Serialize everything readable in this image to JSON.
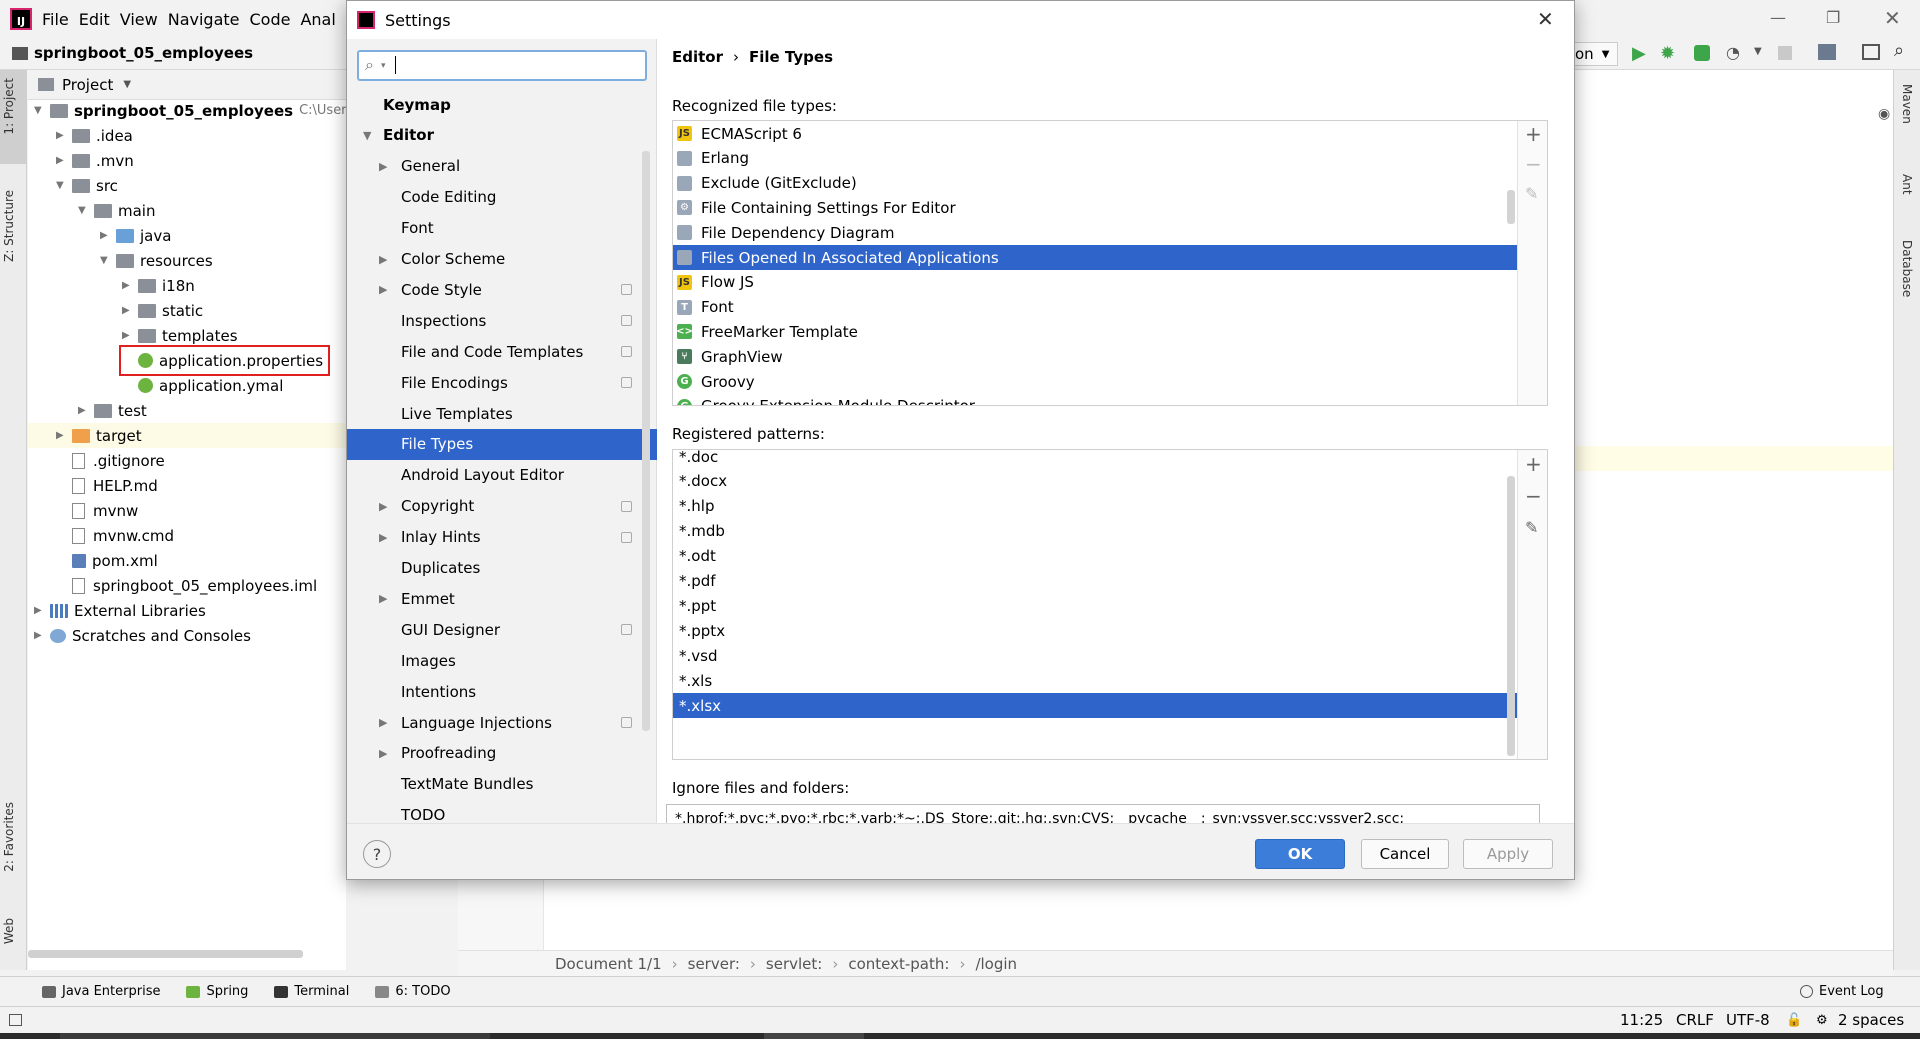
{
  "ide": {
    "menu": [
      "File",
      "Edit",
      "View",
      "Navigate",
      "Code",
      "Anal"
    ],
    "project_name": "springboot_05_employees",
    "project_tab": "Project",
    "left_tabs": [
      "1: Project",
      "Z: Structure",
      "2: Favorites",
      "Web"
    ],
    "right_tabs": [
      "Maven",
      "Ant",
      "Database"
    ],
    "run_config_partial": "on",
    "tree": [
      {
        "label": "springboot_05_employees",
        "extra": "C:\\Users\\",
        "indent": 0,
        "expanded": true,
        "icon": "folder-module"
      },
      {
        "label": ".idea",
        "indent": 1,
        "expanded": false,
        "icon": "folder"
      },
      {
        "label": ".mvn",
        "indent": 1,
        "expanded": false,
        "icon": "folder"
      },
      {
        "label": "src",
        "indent": 1,
        "expanded": true,
        "icon": "folder"
      },
      {
        "label": "main",
        "indent": 2,
        "expanded": true,
        "icon": "folder"
      },
      {
        "label": "java",
        "indent": 3,
        "expanded": false,
        "icon": "folder-blue"
      },
      {
        "label": "resources",
        "indent": 3,
        "expanded": true,
        "icon": "folder"
      },
      {
        "label": "i18n",
        "indent": 4,
        "expanded": false,
        "icon": "folder"
      },
      {
        "label": "static",
        "indent": 4,
        "expanded": false,
        "icon": "folder"
      },
      {
        "label": "templates",
        "indent": 4,
        "expanded": false,
        "icon": "folder"
      },
      {
        "label": "application.properties",
        "indent": 4,
        "leaf": true,
        "icon": "spring-file",
        "highlighted": true
      },
      {
        "label": "application.ymal",
        "indent": 4,
        "leaf": true,
        "icon": "spring-file"
      },
      {
        "label": "test",
        "indent": 2,
        "expanded": false,
        "icon": "folder"
      },
      {
        "label": "target",
        "indent": 1,
        "expanded": false,
        "icon": "folder-orange"
      },
      {
        "label": ".gitignore",
        "indent": 1,
        "leaf": true,
        "icon": "file"
      },
      {
        "label": "HELP.md",
        "indent": 1,
        "leaf": true,
        "icon": "md-file"
      },
      {
        "label": "mvnw",
        "indent": 1,
        "leaf": true,
        "icon": "file"
      },
      {
        "label": "mvnw.cmd",
        "indent": 1,
        "leaf": true,
        "icon": "file"
      },
      {
        "label": "pom.xml",
        "indent": 1,
        "leaf": true,
        "icon": "maven-file"
      },
      {
        "label": "springboot_05_employees.iml",
        "indent": 1,
        "leaf": true,
        "icon": "file"
      },
      {
        "label": "External Libraries",
        "indent": 0,
        "expanded": false,
        "icon": "library"
      },
      {
        "label": "Scratches and Consoles",
        "indent": 0,
        "expanded": false,
        "icon": "scratches"
      }
    ],
    "breadcrumb": [
      "Document 1/1",
      "server:",
      "servlet:",
      "context-path:",
      "/login"
    ],
    "tool_windows": [
      "Java Enterprise",
      "Spring",
      "Terminal",
      "6: TODO"
    ],
    "event_log": "Event Log",
    "status": {
      "position": "11:25",
      "line_sep": "CRLF",
      "encoding": "UTF-8",
      "indent": "2 spaces"
    }
  },
  "dialog": {
    "title": "Settings",
    "search": {
      "value": "",
      "placeholder": ""
    },
    "nav": [
      {
        "label": "Keymap",
        "level": 0,
        "bold": true
      },
      {
        "label": "Editor",
        "level": 0,
        "bold": true,
        "expanded": true
      },
      {
        "label": "General",
        "level": 1,
        "arrow": true
      },
      {
        "label": "Code Editing",
        "level": 1
      },
      {
        "label": "Font",
        "level": 1
      },
      {
        "label": "Color Scheme",
        "level": 1,
        "arrow": true
      },
      {
        "label": "Code Style",
        "level": 1,
        "arrow": true,
        "project": true
      },
      {
        "label": "Inspections",
        "level": 1,
        "project": true
      },
      {
        "label": "File and Code Templates",
        "level": 1,
        "project": true
      },
      {
        "label": "File Encodings",
        "level": 1,
        "project": true
      },
      {
        "label": "Live Templates",
        "level": 1
      },
      {
        "label": "File Types",
        "level": 1,
        "selected": true
      },
      {
        "label": "Android Layout Editor",
        "level": 1
      },
      {
        "label": "Copyright",
        "level": 1,
        "arrow": true,
        "project": true
      },
      {
        "label": "Inlay Hints",
        "level": 1,
        "arrow": true,
        "project": true
      },
      {
        "label": "Duplicates",
        "level": 1
      },
      {
        "label": "Emmet",
        "level": 1,
        "arrow": true
      },
      {
        "label": "GUI Designer",
        "level": 1,
        "project": true
      },
      {
        "label": "Images",
        "level": 1
      },
      {
        "label": "Intentions",
        "level": 1
      },
      {
        "label": "Language Injections",
        "level": 1,
        "arrow": true,
        "project": true
      },
      {
        "label": "Proofreading",
        "level": 1,
        "arrow": true
      },
      {
        "label": "TextMate Bundles",
        "level": 1
      },
      {
        "label": "TODO",
        "level": 1
      }
    ],
    "breadcrumb": [
      "Editor",
      "File Types"
    ],
    "recognized_label": "Recognized file types:",
    "file_types": [
      {
        "label": "ECMAScript 6",
        "icon": "js-icon",
        "color": "#f1c40f"
      },
      {
        "label": "Erlang",
        "icon": "erlang-icon",
        "color": "#9aa7b8"
      },
      {
        "label": "Exclude (GitExclude)",
        "icon": "git-icon",
        "color": "#9aa7b8"
      },
      {
        "label": "File Containing Settings For Editor",
        "icon": "gear-icon",
        "color": "#9aa7b8"
      },
      {
        "label": "File Dependency Diagram",
        "icon": "diagram-icon",
        "color": "#9aa7b8"
      },
      {
        "label": "Files Opened In Associated Applications",
        "icon": "external-file-icon",
        "color": "#9aa7b8",
        "selected": true
      },
      {
        "label": "Flow JS",
        "icon": "js-icon",
        "color": "#f1c40f"
      },
      {
        "label": "Font",
        "icon": "font-icon",
        "color": "#9aa7b8"
      },
      {
        "label": "FreeMarker Template",
        "icon": "freemarker-icon",
        "color": "#4caf50"
      },
      {
        "label": "GraphView",
        "icon": "graph-icon",
        "color": "#4a7b5c"
      },
      {
        "label": "Groovy",
        "icon": "groovy-icon",
        "color": "#4caf50"
      },
      {
        "label": "Groovy Extension Module Descriptor",
        "icon": "groovy-icon",
        "color": "#4caf50"
      }
    ],
    "patterns_label": "Registered patterns:",
    "patterns": [
      "*.doc",
      "*.docx",
      "*.hlp",
      "*.mdb",
      "*.odt",
      "*.pdf",
      "*.ppt",
      "*.pptx",
      "*.vsd",
      "*.xls",
      "*.xlsx"
    ],
    "selected_pattern": "*.xlsx",
    "ignore_label": "Ignore files and folders:",
    "ignore_value": "*.hprof;*.pyc;*.pyo;*.rbc;*.yarb;*~;.DS_Store;.git;.hg;.svn;CVS;__pycache__;_svn;vssver.scc;vssver2.scc;",
    "buttons": {
      "ok": "OK",
      "cancel": "Cancel",
      "apply": "Apply"
    },
    "accent": "#2f65ca"
  }
}
